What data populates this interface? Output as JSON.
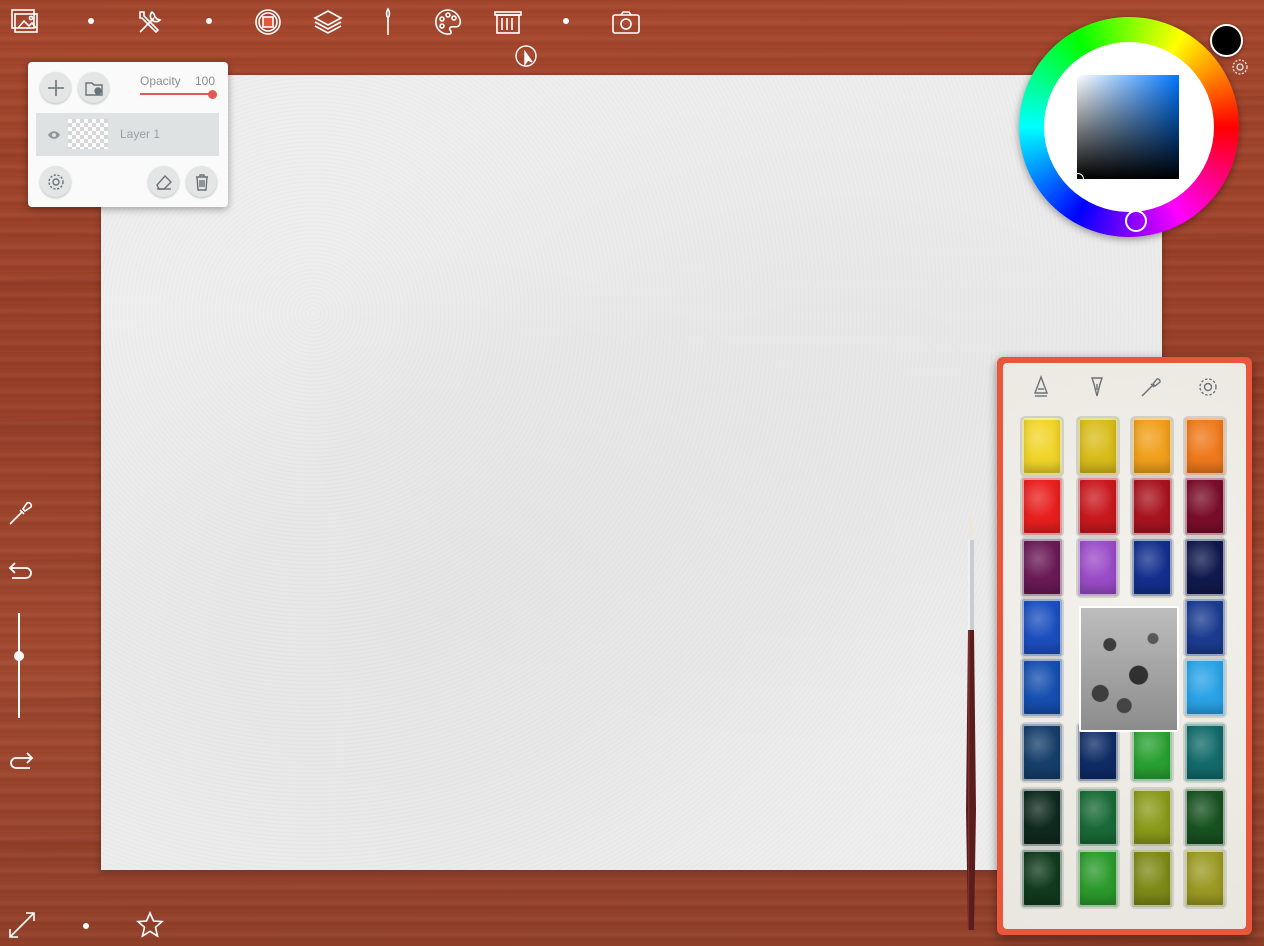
{
  "toolbar": {
    "items": [
      "gallery-icon",
      "tools-icon",
      "record-icon",
      "layers-icon",
      "brush-icon",
      "palette-icon",
      "paper-icon",
      "camera-icon"
    ],
    "cursor_icon": "touch-cursor-icon"
  },
  "layers_panel": {
    "opacity_label": "Opacity",
    "opacity_value": "100",
    "opacity_fraction": 1.0,
    "layers": [
      {
        "name": "Layer 1",
        "visible": true
      }
    ],
    "buttons": [
      "add-layer",
      "import-image",
      "layer-settings",
      "clear-layer",
      "delete-layer"
    ]
  },
  "color_picker": {
    "current_color": "#000000",
    "hue_color": "#0077ff"
  },
  "left_toolbar": {
    "tools": [
      "eyedropper",
      "undo",
      "brush-size",
      "redo"
    ]
  },
  "paint_box": {
    "tools": [
      "pen-tip",
      "ink-nib",
      "eyedropper",
      "settings"
    ],
    "columns": [
      [
        "#f1d52a",
        "#e8201f",
        "#6a1a55",
        "#1c4fbf",
        "#164fb0",
        "#163f6b",
        "#0f2a1f",
        "#123b1e"
      ],
      [
        "#d9bd1c",
        "#c9191e",
        "#9b4cc8",
        "#0f3a7a",
        "#23355e",
        "#0f2c66",
        "#1a6a36",
        "#2c9a2c"
      ],
      [
        "#f0a01b",
        "#a8141f",
        "#14308e",
        "#0d2c3a",
        "#12204a",
        "#2aa032",
        "#8a9a1a",
        "#7e8a18"
      ],
      [
        "#ef7a1c",
        "#7a0e2a",
        "#111a4e",
        "#1b3c90",
        "#2aa3e6",
        "#136b6a",
        "#185220",
        "#9b9a24"
      ]
    ]
  },
  "bottom": {
    "items": [
      "fullscreen-icon",
      "favorite-icon"
    ]
  },
  "colors": {
    "wood": "#a1462e",
    "paper": "#ededed",
    "accent": "#e25a55",
    "paint_box": "#e8573c"
  }
}
